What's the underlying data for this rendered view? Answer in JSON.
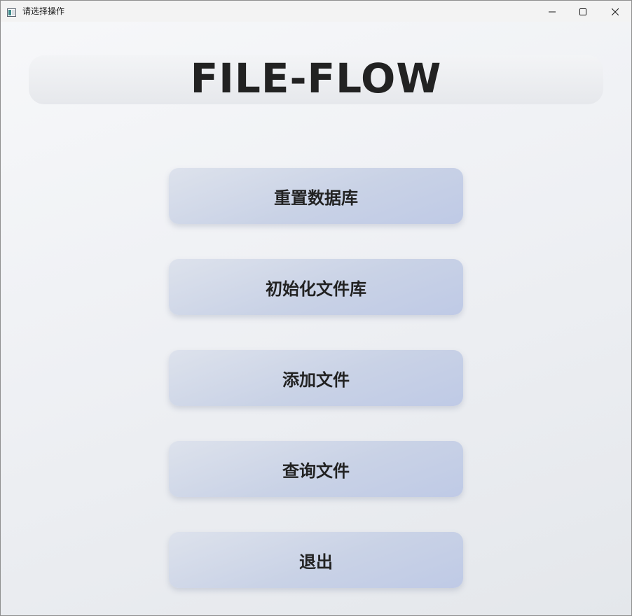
{
  "window": {
    "title": "请选择操作",
    "icon": "app-window-icon"
  },
  "controls": {
    "minimize_icon": "minimize-icon",
    "maximize_icon": "maximize-icon",
    "close_icon": "close-icon"
  },
  "main": {
    "heading": "FILE-FLOW",
    "buttons": [
      {
        "label": "重置数据库"
      },
      {
        "label": "初始化文件库"
      },
      {
        "label": "添加文件"
      },
      {
        "label": "查询文件"
      },
      {
        "label": "退出"
      }
    ]
  },
  "colors": {
    "button_gradient_start": "#dde2ec",
    "button_gradient_end": "#bfcae6",
    "text": "#222222",
    "titlebar": "#f3f3f3"
  }
}
